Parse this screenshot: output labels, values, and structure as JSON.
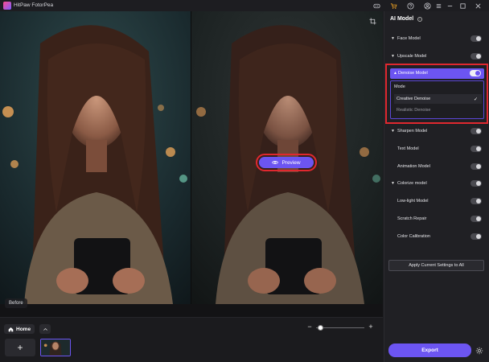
{
  "app": {
    "title": "HitPaw FotorPea"
  },
  "titlebar": {
    "icons": [
      "discord-icon",
      "cart-icon",
      "help-icon",
      "account-icon",
      "menu-icon",
      "minimize-icon",
      "maximize-icon",
      "close-icon"
    ]
  },
  "canvas": {
    "before_label": "Before",
    "preview_label": "Preview"
  },
  "bottom": {
    "home_label": "Home",
    "add_label": "+",
    "zoom_minus": "−",
    "zoom_plus": "+",
    "zoom_level": 0.08
  },
  "panel": {
    "title": "AI Model",
    "models": [
      {
        "label": "Face Model",
        "expandable": true,
        "on": false
      },
      {
        "label": "Upscale Model",
        "expandable": true,
        "on": false
      },
      {
        "label": "Denoise Model",
        "expandable": true,
        "on": true,
        "active": true
      },
      {
        "label": "Sharpen Model",
        "expandable": true,
        "on": false
      },
      {
        "label": "Text Model",
        "expandable": false,
        "on": false
      },
      {
        "label": "Animation Model",
        "expandable": false,
        "on": false
      },
      {
        "label": "Colorize model",
        "expandable": true,
        "on": false
      },
      {
        "label": "Low-light Model",
        "expandable": false,
        "on": false
      },
      {
        "label": "Scratch Repair",
        "expandable": false,
        "on": false
      },
      {
        "label": "Color Calibration",
        "expandable": false,
        "on": false
      }
    ],
    "denoise": {
      "mode_title": "Mode",
      "options": [
        "Creative Denoise",
        "Realistic Denoise"
      ],
      "selected": "Creative Denoise"
    },
    "apply_label": "Apply Current Settings to All",
    "export_label": "Export"
  },
  "colors": {
    "accent": "#6c55f2",
    "highlight": "#e0282f",
    "panel_bg": "#202024"
  }
}
